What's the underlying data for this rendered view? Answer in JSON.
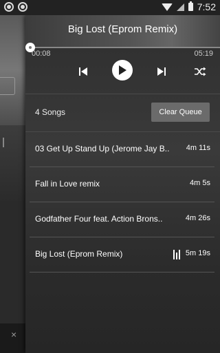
{
  "status_bar": {
    "time": "7:52",
    "left_icons": [
      "app-notification-icon",
      "app-notification-icon"
    ],
    "right_icons": [
      "wifi-icon",
      "signal-icon",
      "battery-icon"
    ]
  },
  "background_panel": {
    "close_glyph": "×"
  },
  "player": {
    "now_playing_title": "Big Lost (Eprom Remix)",
    "elapsed": "00:08",
    "total": "05:19",
    "progress_fraction": 0.025,
    "controls": {
      "previous_icon": "skip-previous-icon",
      "play_icon": "play-icon",
      "next_icon": "skip-next-icon",
      "shuffle_icon": "shuffle-icon"
    }
  },
  "queue": {
    "count_label": "4 Songs",
    "clear_label": "Clear Queue",
    "songs": [
      {
        "title": "03 Get Up Stand Up (Jerome Jay B..",
        "duration": "4m 11s",
        "playing": false
      },
      {
        "title": "Fall in Love remix",
        "duration": "4m 5s",
        "playing": false
      },
      {
        "title": "Godfather Four feat. Action Brons..",
        "duration": "4m 26s",
        "playing": false
      },
      {
        "title": "Big Lost (Eprom Remix)",
        "duration": "5m 19s",
        "playing": true
      }
    ]
  },
  "colors": {
    "accent": "#ffffff",
    "clear_button": "#6b6b6b",
    "panel": "#333333"
  }
}
